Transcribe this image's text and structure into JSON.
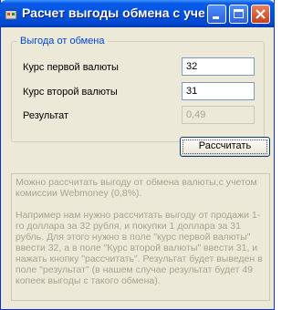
{
  "window": {
    "title": "Расчет выгоды обмена с учет...",
    "icon": "app-icon"
  },
  "group": {
    "legend": "Выгода от обмена",
    "fields": [
      {
        "label": "Курс первой валюты",
        "value": "32"
      },
      {
        "label": "Курс второй валюты",
        "value": "31"
      },
      {
        "label": "Результат",
        "value": "0,49"
      }
    ]
  },
  "actions": {
    "calculate_label": "Рассчитать"
  },
  "description": {
    "p1": "Можно рассчитать выгоду от обмена валюты,с учетом комиссии Webmoney (0,8%).",
    "p2": "Например нам нужно рассчитать выгоду от продажи 1-го доллара за 32 рубля, и покупки 1 доллара за 31 рубль. Для этого нужно в поле \"курс первой валюты\" ввести 32, а в поле \"Курс второй валюты\" ввести 31, и нажать кнопку \"рассчитать\". Результат будет выведен в поле \"результат\" (в нашем случае результат будет 49 копеек выгоды с такого обмена)."
  },
  "colors": {
    "titlebar": "#0054e3",
    "window_face": "#ece9d8",
    "group_legend": "#0046d5",
    "disabled_text": "#a6a491"
  }
}
